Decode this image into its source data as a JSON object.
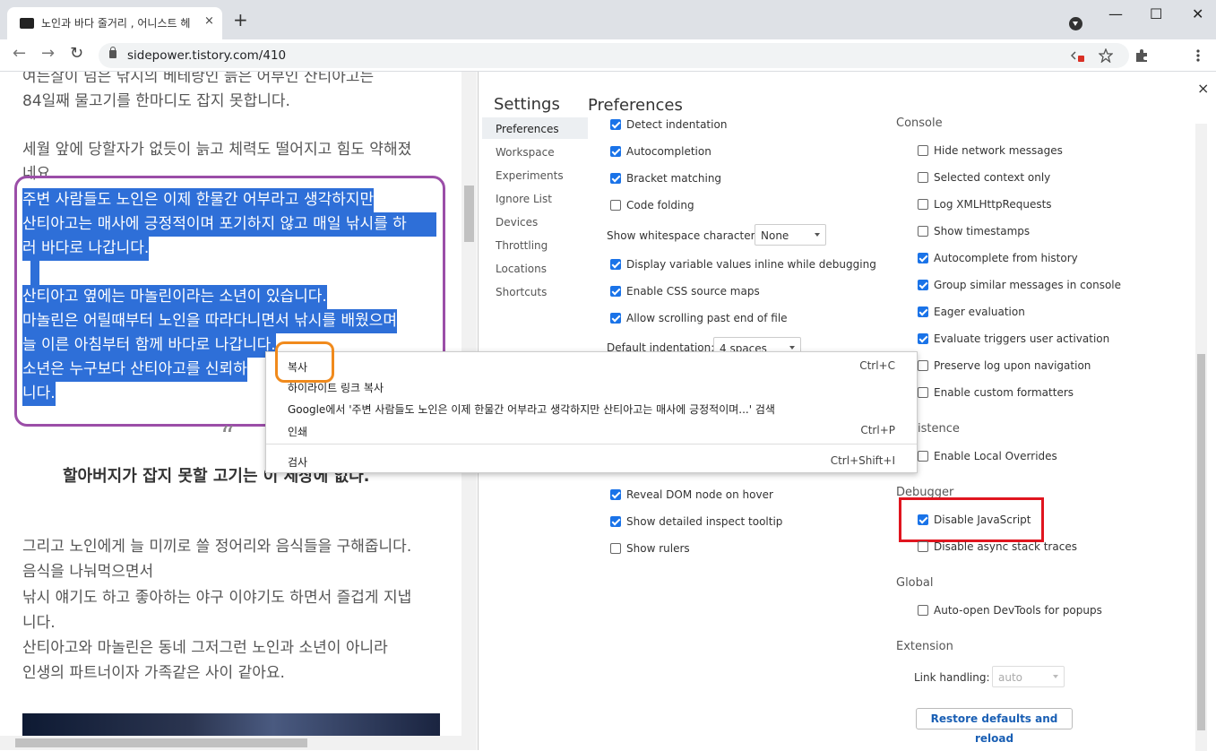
{
  "browser": {
    "tab_title": "노인과 바다 줄거리 , 어니스트 헤",
    "tab_close": "×",
    "new_tab": "+",
    "window_controls": {
      "minimize": "—",
      "maximize": "☐",
      "close": "✕"
    },
    "back": "←",
    "forward": "→",
    "reload": "↻",
    "url": "sidepower.tistory.com/410",
    "icons": [
      "lock-icon",
      "blocked-popup-icon",
      "star-icon",
      "extensions-icon",
      "menu-icon"
    ]
  },
  "article": {
    "lines": [
      "여든살이 넘은 낚시의 베테랑인 늙은 어부인 산티아고는",
      "84일째 물고기를 한마디도 잡지 못합니다.",
      "세월 앞에 당할자가 없듯이 늙고 체력도 떨어지고 힘도 약해졌",
      "네요."
    ],
    "selected_lines": [
      "주변 사람들도 노인은 이제 한물간 어부라고 생각하지만",
      "산티아고는 매사에 긍정적이며 포기하지 않고 매일 낚시를 하",
      "러 바다로 나갑니다.",
      "산티아고 옆에는 마놀린이라는 소년이 있습니다.",
      "마놀린은 어릴때부터 노인을 따라다니면서 낚시를 배웠으며",
      "늘 이른 아침부터 함께 바다로 나갑니다.",
      "소년은 누구보다 산티아고를 신뢰하",
      "니다."
    ],
    "quote_mark": "“",
    "quote": "할아버지가 잡지 못할 고기는 이 세상에 없다.",
    "lines2": [
      "그리고 노인에게 늘 미끼로 쓸 정어리와 음식들을 구해줍니다.",
      "음식을 나눠먹으면서",
      "낚시 얘기도 하고 좋아하는 야구 이야기도 하면서 즐겁게 지냅",
      "니다.",
      "산티아고와 마놀린은 동네 그저그런 노인과 소년이 아니라",
      "인생의 파트너이자 가족같은 사이 같아요."
    ]
  },
  "context_menu": {
    "items": [
      {
        "label": "복사",
        "shortcut": "Ctrl+C"
      },
      {
        "label": "하이라이트 링크 복사",
        "shortcut": ""
      },
      {
        "label": "Google에서 '주변 사람들도 노인은 이제 한물간 어부라고 생각하지만   산티아고는 매사에 긍정적이며...' 검색",
        "shortcut": ""
      },
      {
        "label": "인쇄",
        "shortcut": "Ctrl+P"
      },
      {
        "label": "검사",
        "shortcut": "Ctrl+Shift+I"
      }
    ]
  },
  "devtools": {
    "settings_title": "Settings",
    "panel_title": "Preferences",
    "close": "×",
    "nav": [
      "Preferences",
      "Workspace",
      "Experiments",
      "Ignore List",
      "Devices",
      "Throttling",
      "Locations",
      "Shortcuts"
    ],
    "left": [
      {
        "label": "Detect indentation",
        "checked": true
      },
      {
        "label": "Autocompletion",
        "checked": true
      },
      {
        "label": "Bracket matching",
        "checked": true
      },
      {
        "label": "Code folding",
        "checked": false
      },
      {
        "label": "Display variable values inline while debugging",
        "checked": true
      },
      {
        "label": "Enable CSS source maps",
        "checked": true
      },
      {
        "label": "Allow scrolling past end of file",
        "checked": true
      },
      {
        "label": "Reveal DOM node on hover",
        "checked": true
      },
      {
        "label": "Show detailed inspect tooltip",
        "checked": true
      },
      {
        "label": "Show rulers",
        "checked": false
      }
    ],
    "whitespace_label": "Show whitespace characters:",
    "whitespace_value": "None",
    "indent_label": "Default indentation:",
    "indent_value": "4 spaces",
    "console_section": "Console",
    "console": [
      {
        "label": "Hide network messages",
        "checked": false
      },
      {
        "label": "Selected context only",
        "checked": false
      },
      {
        "label": "Log XMLHttpRequests",
        "checked": false
      },
      {
        "label": "Show timestamps",
        "checked": false
      },
      {
        "label": "Autocomplete from history",
        "checked": true
      },
      {
        "label": "Group similar messages in console",
        "checked": true
      },
      {
        "label": "Eager evaluation",
        "checked": true
      },
      {
        "label": "Evaluate triggers user activation",
        "checked": true
      },
      {
        "label": "Preserve log upon navigation",
        "checked": false
      },
      {
        "label": "Enable custom formatters",
        "checked": false
      }
    ],
    "persistence_section": "istence",
    "persistence": [
      {
        "label": "Enable Local Overrides",
        "checked": false
      }
    ],
    "debugger_section": "Debugger",
    "debugger": [
      {
        "label": "Disable JavaScript",
        "checked": true
      },
      {
        "label": "Disable async stack traces",
        "checked": false
      }
    ],
    "global_section": "Global",
    "global": [
      {
        "label": "Auto-open DevTools for popups",
        "checked": false
      }
    ],
    "extension_section": "Extension",
    "link_handling_label": "Link handling:",
    "link_handling_value": "auto",
    "restore_button": "Restore defaults and reload"
  }
}
